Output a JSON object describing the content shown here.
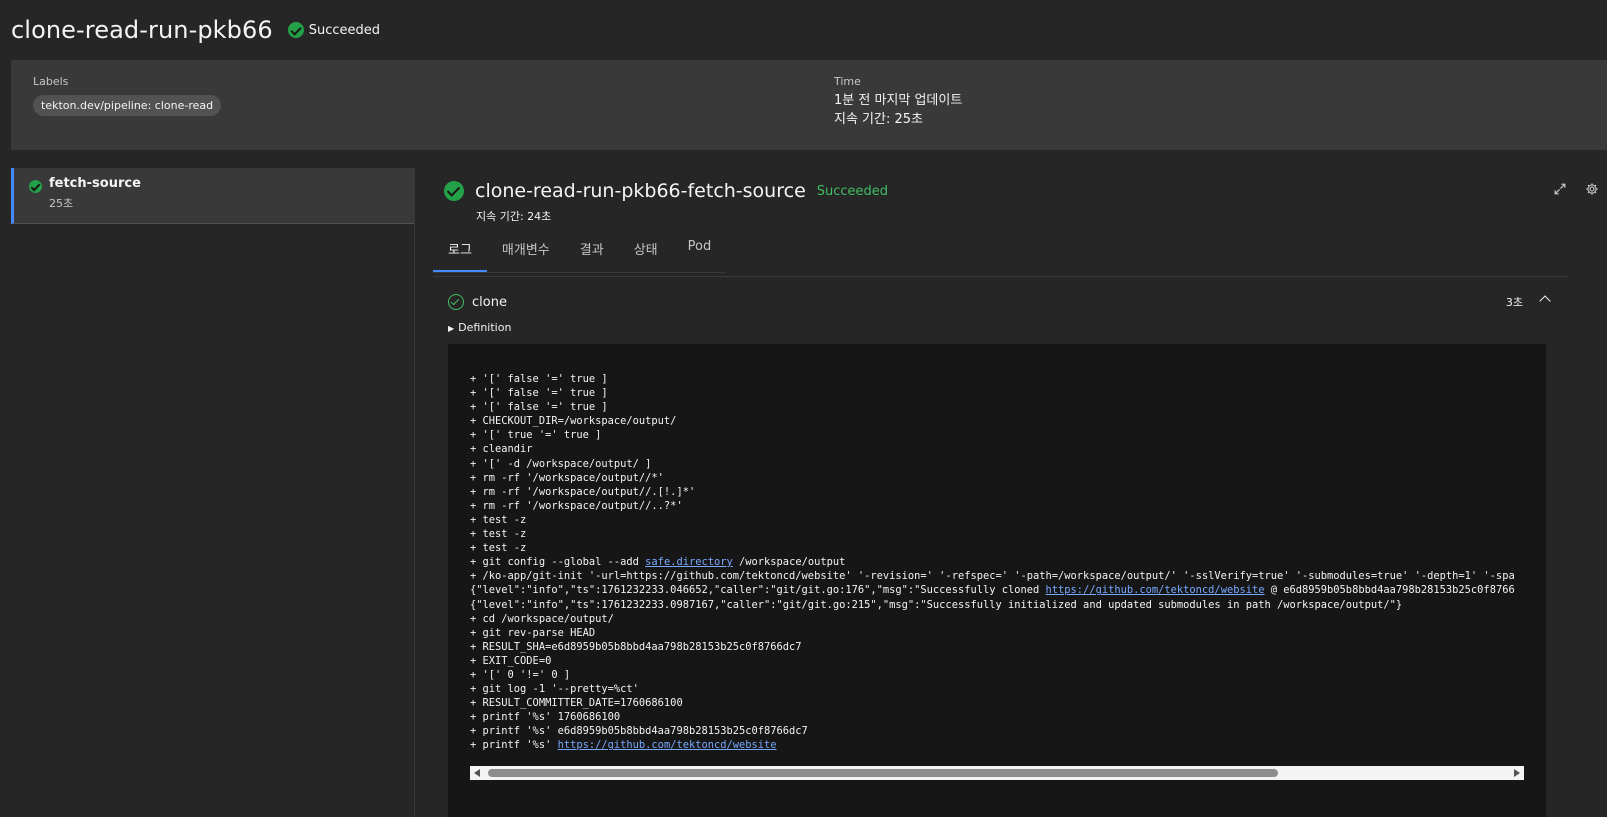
{
  "header": {
    "title": "clone-read-run-pkb66",
    "status": "Succeeded"
  },
  "summary": {
    "labels_heading": "Labels",
    "label_tag": "tekton.dev/pipeline: clone-read",
    "time_heading": "Time",
    "last_updated": "1분 전 마지막 업데이트",
    "duration": "지속 기간: 25초"
  },
  "sidebar": {
    "task_name": "fetch-source",
    "task_duration": "25초"
  },
  "taskrun": {
    "title": "clone-read-run-pkb66-fetch-source",
    "status": "Succeeded",
    "duration": "지속 기간: 24초"
  },
  "tabs": [
    "로그",
    "매개변수",
    "결과",
    "상태",
    "Pod"
  ],
  "step": {
    "name": "clone",
    "duration": "3초",
    "definition": "Definition"
  },
  "log_lines": [
    {
      "pre": "+ '[' false '=' true ]"
    },
    {
      "pre": "+ '[' false '=' true ]"
    },
    {
      "pre": "+ '[' false '=' true ]"
    },
    {
      "pre": "+ CHECKOUT_DIR=/workspace/output/"
    },
    {
      "pre": "+ '[' true '=' true ]"
    },
    {
      "pre": "+ cleandir"
    },
    {
      "pre": "+ '[' -d /workspace/output/ ]"
    },
    {
      "pre": "+ rm -rf '/workspace/output//*'"
    },
    {
      "pre": "+ rm -rf '/workspace/output//.[!.]*'"
    },
    {
      "pre": "+ rm -rf '/workspace/output//..?*'"
    },
    {
      "pre": "+ test -z"
    },
    {
      "pre": "+ test -z"
    },
    {
      "pre": "+ test -z"
    },
    {
      "pre": "+ git config --global --add ",
      "link": "safe.directory",
      "post": " /workspace/output"
    },
    {
      "pre": "+ /ko-app/git-init '-url=https://github.com/tektoncd/website' '-revision=' '-refspec=' '-path=/workspace/output/' '-sslVerify=true' '-submodules=true' '-depth=1' '-spa"
    },
    {
      "pre": "{\"level\":\"info\",\"ts\":1761232233.046652,\"caller\":\"git/git.go:176\",\"msg\":\"Successfully cloned ",
      "link": "https://github.com/tektoncd/website",
      "post": " @ e6d8959b05b8bbd4aa798b28153b25c0f8766"
    },
    {
      "pre": "{\"level\":\"info\",\"ts\":1761232233.0987167,\"caller\":\"git/git.go:215\",\"msg\":\"Successfully initialized and updated submodules in path /workspace/output/\"}"
    },
    {
      "pre": "+ cd /workspace/output/"
    },
    {
      "pre": "+ git rev-parse HEAD"
    },
    {
      "pre": "+ RESULT_SHA=e6d8959b05b8bbd4aa798b28153b25c0f8766dc7"
    },
    {
      "pre": "+ EXIT_CODE=0"
    },
    {
      "pre": "+ '[' 0 '!=' 0 ]"
    },
    {
      "pre": "+ git log -1 '--pretty=%ct'"
    },
    {
      "pre": "+ RESULT_COMMITTER_DATE=1760686100"
    },
    {
      "pre": "+ printf '%s' 1760686100"
    },
    {
      "pre": "+ printf '%s' e6d8959b05b8bbd4aa798b28153b25c0f8766dc7"
    },
    {
      "pre": "+ printf '%s' ",
      "link": "https://github.com/tektoncd/website"
    }
  ],
  "icons": {
    "status": "checkmark-filled-icon",
    "step_status": "checkmark-outline-icon",
    "maximize": "maximize-icon",
    "settings": "gear-icon",
    "collapse": "chevron-up-icon"
  },
  "colors": {
    "success": "#24a148",
    "accent": "#4589ff",
    "link": "#78a9ff",
    "background": "#262626"
  }
}
